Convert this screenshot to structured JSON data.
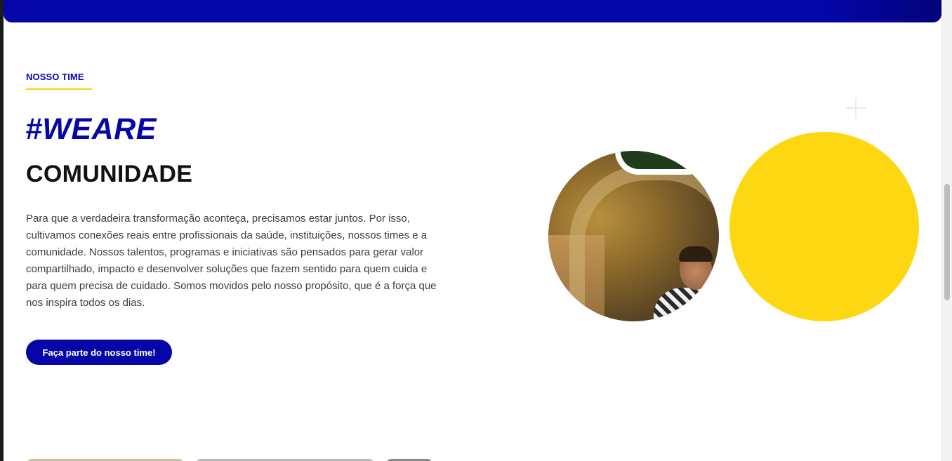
{
  "section": {
    "eyebrow": "NOSSO TIME",
    "hashtag": "#WEARE",
    "headline": "COMUNIDADE",
    "body": "Para que a verdadeira transformação aconteça, precisamos estar juntos. Por isso, cultivamos conexões reais entre profissionais da saúde, instituições, nossos times e a comunidade. Nossos talentos, programas e iniciativas são pensados para gerar valor compartilhado, impacto e desenvolver soluções que fazem sentido para quem cuida e para quem precisa de cuidado. Somos movidos pelo nosso propósito, que é a força que nos inspira todos os dias.",
    "cta_label": "Faça parte do nosso time!"
  },
  "decor": {
    "photo": "team-member-photo",
    "plus_icon": "plus-icon",
    "yellow_circle_color": "#fdd712"
  },
  "colors": {
    "brand_blue": "#0505a8",
    "accent_yellow": "#f7d30f",
    "headline_text": "#111111",
    "body_text": "#3c3c3c"
  }
}
